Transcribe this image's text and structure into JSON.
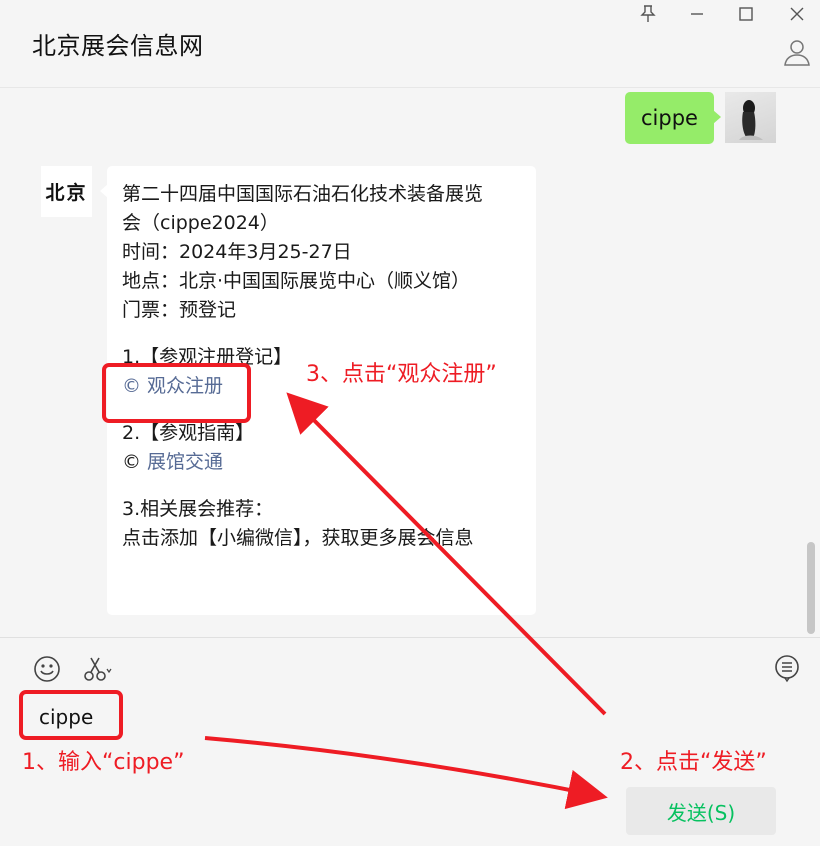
{
  "window": {
    "title": "北京展会信息网",
    "buttons": [
      "pin",
      "minimize",
      "maximize",
      "close"
    ]
  },
  "messages": [
    {
      "sender": "self",
      "text": "cippe"
    },
    {
      "sender": "official-account",
      "avatar_text": "北京",
      "lines": [
        "第二十四届中国国际石油石化技术装备展览",
        "会（cippe2024）",
        "时间：2024年3月25-27日",
        "地点：北京·中国国际展览中心（顺义馆）",
        "门票：预登记"
      ],
      "section1_title": "1.【参观注册登记】",
      "section1_link": "© 观众注册",
      "section2_title": "2.【参观指南】",
      "section2_link_prefix": "© ",
      "section2_link": "展馆交通",
      "section3_title": "3.相关展会推荐：",
      "section3_text": "点击添加【小编微信】，获取更多展会信息"
    }
  ],
  "input": {
    "value": "cippe",
    "send_label": "发送(S)"
  },
  "annotations": {
    "step1": "1、输入“cippe”",
    "step2": "2、点击“发送”",
    "step3": "3、点击“观众注册”",
    "color": "#ee1c24"
  },
  "colors": {
    "self_bubble": "#95ec69",
    "link": "#576b95",
    "send_text": "#07c160"
  }
}
